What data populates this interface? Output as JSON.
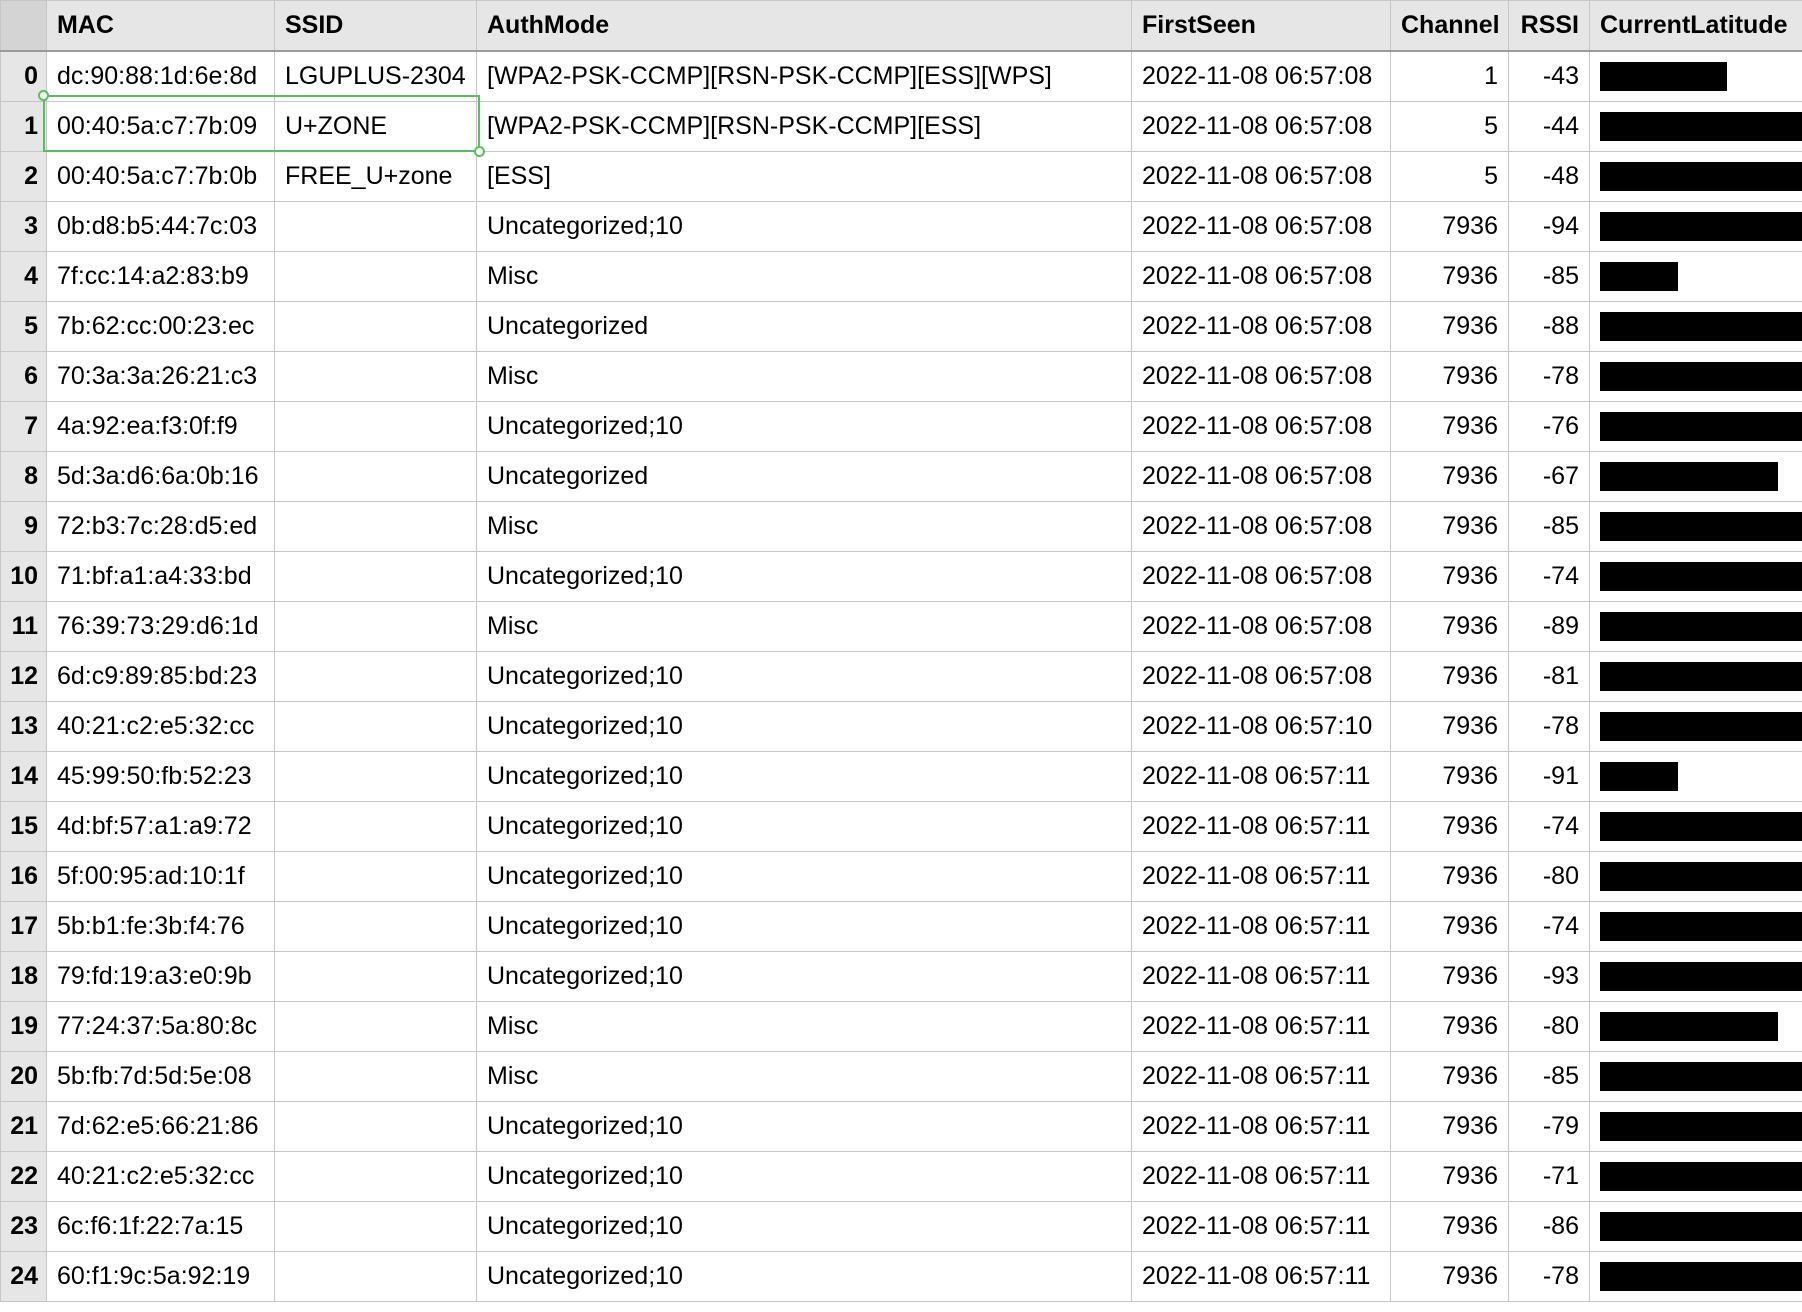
{
  "columns": [
    "MAC",
    "SSID",
    "AuthMode",
    "FirstSeen",
    "Channel",
    "RSSI",
    "CurrentLatitude"
  ],
  "rows": [
    {
      "index": "0",
      "mac": "dc:90:88:1d:6e:8d",
      "ssid": "LGUPLUS-2304",
      "auth": "[WPA2-PSK-CCMP][RSN-PSK-CCMP][ESS][WPS]",
      "first_seen": "2022-11-08 06:57:08",
      "channel": "1",
      "rssi": "-43",
      "latitude_redacted": true,
      "redaction_fill": 0.62
    },
    {
      "index": "1",
      "mac": "00:40:5a:c7:7b:09",
      "ssid": "U+ZONE",
      "auth": "[WPA2-PSK-CCMP][RSN-PSK-CCMP][ESS]",
      "first_seen": "2022-11-08 06:57:08",
      "channel": "5",
      "rssi": "-44",
      "latitude_redacted": true,
      "redaction_fill": 1.0
    },
    {
      "index": "2",
      "mac": "00:40:5a:c7:7b:0b",
      "ssid": "FREE_U+zone",
      "auth": "[ESS]",
      "first_seen": "2022-11-08 06:57:08",
      "channel": "5",
      "rssi": "-48",
      "latitude_redacted": true,
      "redaction_fill": 1.0
    },
    {
      "index": "3",
      "mac": "0b:d8:b5:44:7c:03",
      "ssid": "",
      "auth": "Uncategorized;10",
      "first_seen": "2022-11-08 06:57:08",
      "channel": "7936",
      "rssi": "-94",
      "latitude_redacted": true,
      "redaction_fill": 1.0
    },
    {
      "index": "4",
      "mac": "7f:cc:14:a2:83:b9",
      "ssid": "",
      "auth": "Misc",
      "first_seen": "2022-11-08 06:57:08",
      "channel": "7936",
      "rssi": "-85",
      "latitude_redacted": true,
      "redaction_fill": 0.38
    },
    {
      "index": "5",
      "mac": "7b:62:cc:00:23:ec",
      "ssid": "",
      "auth": "Uncategorized",
      "first_seen": "2022-11-08 06:57:08",
      "channel": "7936",
      "rssi": "-88",
      "latitude_redacted": true,
      "redaction_fill": 1.0
    },
    {
      "index": "6",
      "mac": "70:3a:3a:26:21:c3",
      "ssid": "",
      "auth": "Misc",
      "first_seen": "2022-11-08 06:57:08",
      "channel": "7936",
      "rssi": "-78",
      "latitude_redacted": true,
      "redaction_fill": 1.0
    },
    {
      "index": "7",
      "mac": "4a:92:ea:f3:0f:f9",
      "ssid": "",
      "auth": "Uncategorized;10",
      "first_seen": "2022-11-08 06:57:08",
      "channel": "7936",
      "rssi": "-76",
      "latitude_redacted": true,
      "redaction_fill": 1.0
    },
    {
      "index": "8",
      "mac": "5d:3a:d6:6a:0b:16",
      "ssid": "",
      "auth": "Uncategorized",
      "first_seen": "2022-11-08 06:57:08",
      "channel": "7936",
      "rssi": "-67",
      "latitude_redacted": true,
      "redaction_fill": 0.87
    },
    {
      "index": "9",
      "mac": "72:b3:7c:28:d5:ed",
      "ssid": "",
      "auth": "Misc",
      "first_seen": "2022-11-08 06:57:08",
      "channel": "7936",
      "rssi": "-85",
      "latitude_redacted": true,
      "redaction_fill": 1.0
    },
    {
      "index": "10",
      "mac": "71:bf:a1:a4:33:bd",
      "ssid": "",
      "auth": "Uncategorized;10",
      "first_seen": "2022-11-08 06:57:08",
      "channel": "7936",
      "rssi": "-74",
      "latitude_redacted": true,
      "redaction_fill": 1.0
    },
    {
      "index": "11",
      "mac": "76:39:73:29:d6:1d",
      "ssid": "",
      "auth": "Misc",
      "first_seen": "2022-11-08 06:57:08",
      "channel": "7936",
      "rssi": "-89",
      "latitude_redacted": true,
      "redaction_fill": 1.0
    },
    {
      "index": "12",
      "mac": "6d:c9:89:85:bd:23",
      "ssid": "",
      "auth": "Uncategorized;10",
      "first_seen": "2022-11-08 06:57:08",
      "channel": "7936",
      "rssi": "-81",
      "latitude_redacted": true,
      "redaction_fill": 1.0
    },
    {
      "index": "13",
      "mac": "40:21:c2:e5:32:cc",
      "ssid": "",
      "auth": "Uncategorized;10",
      "first_seen": "2022-11-08 06:57:10",
      "channel": "7936",
      "rssi": "-78",
      "latitude_redacted": true,
      "redaction_fill": 1.0
    },
    {
      "index": "14",
      "mac": "45:99:50:fb:52:23",
      "ssid": "",
      "auth": "Uncategorized;10",
      "first_seen": "2022-11-08 06:57:11",
      "channel": "7936",
      "rssi": "-91",
      "latitude_redacted": true,
      "redaction_fill": 0.38
    },
    {
      "index": "15",
      "mac": "4d:bf:57:a1:a9:72",
      "ssid": "",
      "auth": "Uncategorized;10",
      "first_seen": "2022-11-08 06:57:11",
      "channel": "7936",
      "rssi": "-74",
      "latitude_redacted": true,
      "redaction_fill": 1.0
    },
    {
      "index": "16",
      "mac": "5f:00:95:ad:10:1f",
      "ssid": "",
      "auth": "Uncategorized;10",
      "first_seen": "2022-11-08 06:57:11",
      "channel": "7936",
      "rssi": "-80",
      "latitude_redacted": true,
      "redaction_fill": 1.0
    },
    {
      "index": "17",
      "mac": "5b:b1:fe:3b:f4:76",
      "ssid": "",
      "auth": "Uncategorized;10",
      "first_seen": "2022-11-08 06:57:11",
      "channel": "7936",
      "rssi": "-74",
      "latitude_redacted": true,
      "redaction_fill": 1.0
    },
    {
      "index": "18",
      "mac": "79:fd:19:a3:e0:9b",
      "ssid": "",
      "auth": "Uncategorized;10",
      "first_seen": "2022-11-08 06:57:11",
      "channel": "7936",
      "rssi": "-93",
      "latitude_redacted": true,
      "redaction_fill": 1.0
    },
    {
      "index": "19",
      "mac": "77:24:37:5a:80:8c",
      "ssid": "",
      "auth": "Misc",
      "first_seen": "2022-11-08 06:57:11",
      "channel": "7936",
      "rssi": "-80",
      "latitude_redacted": true,
      "redaction_fill": 0.87
    },
    {
      "index": "20",
      "mac": "5b:fb:7d:5d:5e:08",
      "ssid": "",
      "auth": "Misc",
      "first_seen": "2022-11-08 06:57:11",
      "channel": "7936",
      "rssi": "-85",
      "latitude_redacted": true,
      "redaction_fill": 1.0
    },
    {
      "index": "21",
      "mac": "7d:62:e5:66:21:86",
      "ssid": "",
      "auth": "Uncategorized;10",
      "first_seen": "2022-11-08 06:57:11",
      "channel": "7936",
      "rssi": "-79",
      "latitude_redacted": true,
      "redaction_fill": 1.0
    },
    {
      "index": "22",
      "mac": "40:21:c2:e5:32:cc",
      "ssid": "",
      "auth": "Uncategorized;10",
      "first_seen": "2022-11-08 06:57:11",
      "channel": "7936",
      "rssi": "-71",
      "latitude_redacted": true,
      "redaction_fill": 1.0
    },
    {
      "index": "23",
      "mac": "6c:f6:1f:22:7a:15",
      "ssid": "",
      "auth": "Uncategorized;10",
      "first_seen": "2022-11-08 06:57:11",
      "channel": "7936",
      "rssi": "-86",
      "latitude_redacted": true,
      "redaction_fill": 1.0
    },
    {
      "index": "24",
      "mac": "60:f1:9c:5a:92:19",
      "ssid": "",
      "auth": "Uncategorized;10",
      "first_seen": "2022-11-08 06:57:11",
      "channel": "7936",
      "rssi": "-78",
      "latitude_redacted": true,
      "redaction_fill": 1.0
    }
  ],
  "selection": {
    "rows": [
      "1"
    ],
    "columns": [
      "MAC",
      "SSID"
    ]
  },
  "colors": {
    "header_bg": "#e6e6e6",
    "grid": "#c6c6c6",
    "selection": "#58c05a",
    "redaction": "#000000"
  }
}
